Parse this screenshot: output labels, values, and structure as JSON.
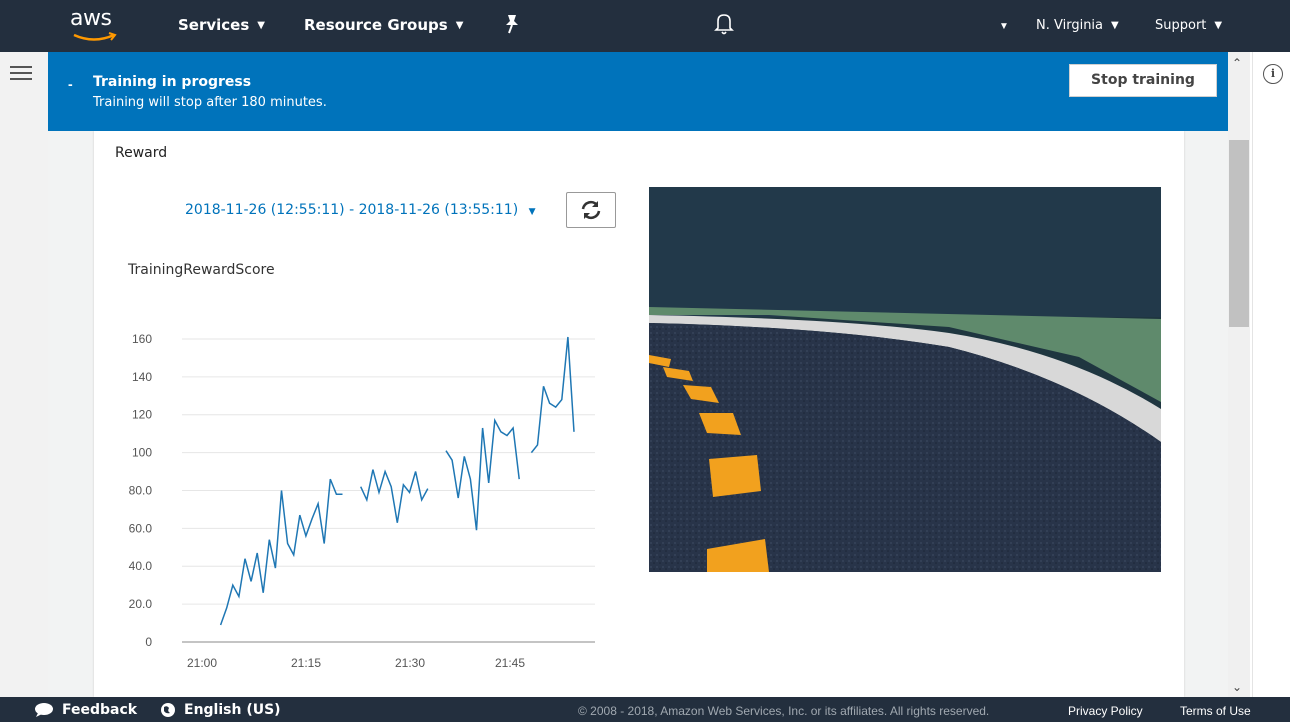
{
  "topnav": {
    "logo": "aws",
    "services": "Services",
    "resource_groups": "Resource Groups",
    "region": "N. Virginia",
    "support": "Support"
  },
  "banner": {
    "title": "Training in progress",
    "subtitle": "Training will stop after 180 minutes.",
    "stop_button": "Stop training"
  },
  "card": {
    "title": "Reward",
    "date_range": "2018-11-26 (12:55:11) - 2018-11-26 (13:55:11)",
    "metric_title": "TrainingRewardScore"
  },
  "chart_data": {
    "type": "line",
    "title": "TrainingRewardScore",
    "xlabel": "",
    "ylabel": "",
    "ylim": [
      0,
      170
    ],
    "yticks": [
      "0",
      "20.0",
      "40.0",
      "60.0",
      "80.0",
      "100",
      "120",
      "140",
      "160"
    ],
    "xticks": [
      "21:00",
      "21:15",
      "21:30",
      "21:45"
    ],
    "grid": true,
    "series": [
      {
        "color": "#1f77b4",
        "segments": [
          [
            [
              20.7,
              9
            ],
            [
              21.6,
              18
            ],
            [
              22.5,
              30
            ],
            [
              23.4,
              24
            ],
            [
              24.3,
              44
            ],
            [
              25.2,
              32
            ],
            [
              26.1,
              47
            ],
            [
              27.0,
              26
            ],
            [
              27.9,
              54
            ],
            [
              28.8,
              39
            ],
            [
              29.7,
              80
            ],
            [
              30.6,
              52
            ],
            [
              31.5,
              46
            ],
            [
              32.4,
              67
            ],
            [
              33.3,
              56
            ],
            [
              34.2,
              65
            ],
            [
              35.1,
              73
            ],
            [
              36.0,
              52
            ],
            [
              36.9,
              86
            ],
            [
              37.8,
              78
            ],
            [
              38.7,
              78
            ]
          ],
          [
            [
              41.4,
              82
            ],
            [
              42.3,
              75
            ],
            [
              43.2,
              91
            ],
            [
              44.1,
              79
            ],
            [
              45.0,
              90
            ],
            [
              45.9,
              82
            ],
            [
              46.8,
              63
            ],
            [
              47.7,
              83
            ],
            [
              48.6,
              79
            ],
            [
              49.5,
              90
            ],
            [
              50.4,
              75
            ],
            [
              51.3,
              81
            ]
          ],
          [
            [
              54.0,
              101
            ],
            [
              54.9,
              96
            ],
            [
              55.8,
              76
            ],
            [
              56.7,
              98
            ],
            [
              57.6,
              86
            ],
            [
              58.5,
              59
            ],
            [
              59.4,
              113
            ],
            [
              60.3,
              84
            ],
            [
              61.2,
              117
            ],
            [
              62.1,
              111
            ],
            [
              63.0,
              109
            ],
            [
              63.9,
              113
            ],
            [
              64.8,
              86
            ]
          ],
          [
            [
              66.6,
              100
            ],
            [
              67.5,
              104
            ],
            [
              68.4,
              135
            ],
            [
              69.3,
              126
            ],
            [
              70.2,
              124
            ],
            [
              71.1,
              128
            ],
            [
              72.0,
              161
            ],
            [
              72.9,
              111
            ]
          ]
        ]
      }
    ]
  },
  "footer": {
    "feedback": "Feedback",
    "language": "English (US)",
    "copyright": "© 2008 - 2018, Amazon Web Services, Inc. or its affiliates. All rights reserved.",
    "privacy": "Privacy Policy",
    "terms": "Terms of Use"
  }
}
